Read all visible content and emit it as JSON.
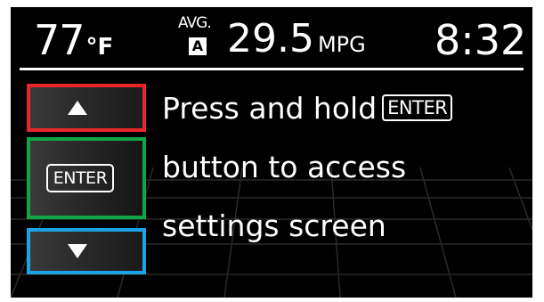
{
  "status_bar": {
    "temperature": "77",
    "temperature_unit": "°F",
    "avg_label": "AVG.",
    "trip_label": "A",
    "fuel_economy": "29.5",
    "fuel_economy_unit": "MPG",
    "clock": "8:32"
  },
  "controls": {
    "up_icon": "up-arrow-icon",
    "enter_label": "ENTER",
    "down_icon": "down-arrow-icon",
    "up_border_color": "#e8262a",
    "enter_border_color": "#11a44a",
    "down_border_color": "#1ca3e4"
  },
  "message": {
    "line1": "Press and hold",
    "line1_badge": "ENTER",
    "line2": "button to access",
    "line3": "settings screen"
  },
  "colors": {
    "background": "#000000",
    "text": "#ffffff"
  }
}
